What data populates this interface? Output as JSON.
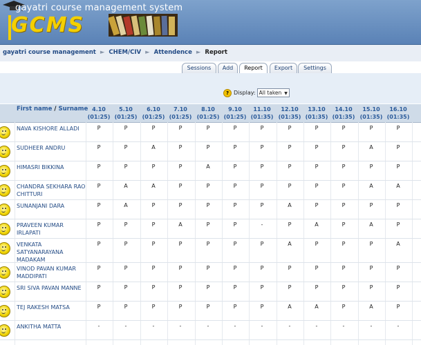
{
  "header": {
    "site_name": "gayatri course management system",
    "logo_text": "GCMS"
  },
  "breadcrumb": [
    "gayatri course management",
    "CHEM/CIV",
    "Attendence",
    "Report"
  ],
  "tabs": [
    "Sessions",
    "Add",
    "Report",
    "Export",
    "Settings"
  ],
  "display": {
    "label": "Display:",
    "value": "All taken"
  },
  "table": {
    "name_header": "First name",
    "name_header_sep": "/",
    "surname_header": "Surname",
    "columns": [
      {
        "date": "4.10",
        "time": "(01:25)"
      },
      {
        "date": "5.10",
        "time": "(01:25)"
      },
      {
        "date": "6.10",
        "time": "(01:25)"
      },
      {
        "date": "7.10",
        "time": "(01:25)"
      },
      {
        "date": "8.10",
        "time": "(01:25)"
      },
      {
        "date": "9.10",
        "time": "(01:25)"
      },
      {
        "date": "11.10",
        "time": "(01:35)"
      },
      {
        "date": "12.10",
        "time": "(01:35)"
      },
      {
        "date": "13.10",
        "time": "(01:35)"
      },
      {
        "date": "14.10",
        "time": "(01:35)"
      },
      {
        "date": "15.10",
        "time": "(01:35)"
      },
      {
        "date": "16.10",
        "time": "(01:35)"
      }
    ],
    "rows": [
      {
        "name": "NAVA KISHORE ALLADI",
        "marks": [
          "P",
          "P",
          "P",
          "P",
          "P",
          "P",
          "P",
          "P",
          "P",
          "P",
          "P",
          "P"
        ]
      },
      {
        "name": "SUDHEER ANDRU",
        "marks": [
          "P",
          "P",
          "A",
          "P",
          "P",
          "P",
          "P",
          "P",
          "P",
          "P",
          "A",
          "P"
        ]
      },
      {
        "name": "HIMASRI BIKKINA",
        "marks": [
          "P",
          "P",
          "P",
          "P",
          "A",
          "P",
          "P",
          "P",
          "P",
          "P",
          "P",
          "P"
        ]
      },
      {
        "name": "CHANDRA SEKHARA RAO CHITTURI",
        "marks": [
          "P",
          "A",
          "A",
          "P",
          "P",
          "P",
          "P",
          "P",
          "P",
          "P",
          "A",
          "A"
        ]
      },
      {
        "name": "SUNANJANI DARA",
        "marks": [
          "P",
          "A",
          "P",
          "P",
          "P",
          "P",
          "P",
          "A",
          "P",
          "P",
          "P",
          "P"
        ]
      },
      {
        "name": "PRAVEEN KUMAR IRLAPATI",
        "marks": [
          "P",
          "P",
          "P",
          "A",
          "P",
          "P",
          "-",
          "P",
          "A",
          "P",
          "A",
          "P"
        ]
      },
      {
        "name": "VENKATA SATYANARAYANA MADAKAM",
        "marks": [
          "P",
          "P",
          "P",
          "P",
          "P",
          "P",
          "P",
          "A",
          "P",
          "P",
          "P",
          "A"
        ]
      },
      {
        "name": "VINOD PAVAN KUMAR MADDIPATI",
        "marks": [
          "P",
          "P",
          "P",
          "P",
          "P",
          "P",
          "P",
          "P",
          "P",
          "P",
          "P",
          "P"
        ]
      },
      {
        "name": "SRI SIVA PAVAN MANNE",
        "marks": [
          "P",
          "P",
          "P",
          "P",
          "P",
          "P",
          "P",
          "P",
          "P",
          "P",
          "P",
          "P"
        ]
      },
      {
        "name": "TEJ RAKESH MATSA",
        "marks": [
          "P",
          "P",
          "P",
          "P",
          "P",
          "P",
          "P",
          "A",
          "A",
          "P",
          "A",
          "P"
        ]
      },
      {
        "name": "ANKITHA MATTA",
        "marks": [
          "-",
          "-",
          "-",
          "-",
          "-",
          "-",
          "-",
          "-",
          "-",
          "-",
          "-",
          "-"
        ]
      }
    ]
  }
}
